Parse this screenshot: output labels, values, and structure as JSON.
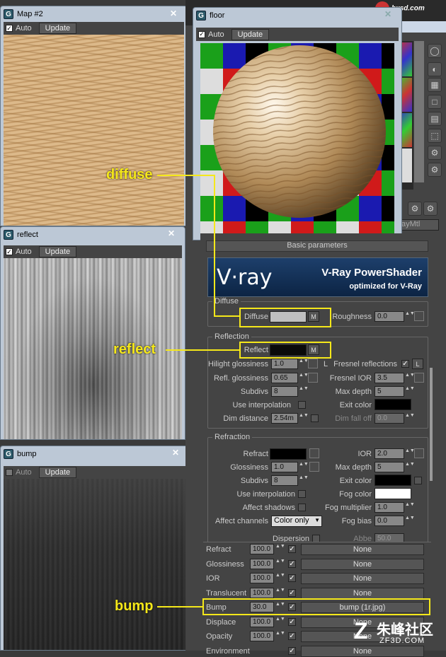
{
  "windows": {
    "map2": {
      "title": "Map #2",
      "auto": "Auto",
      "update": "Update"
    },
    "floor": {
      "title": "floor",
      "auto": "Auto",
      "update": "Update"
    },
    "reflect": {
      "title": "reflect",
      "auto": "Auto",
      "update": "Update"
    },
    "bump": {
      "title": "bump",
      "auto": "Auto",
      "update": "Update"
    }
  },
  "watermarks": {
    "top": "hxsd.com",
    "bottom_cn": "朱峰社区",
    "bottom_en": "ZF3D.COM"
  },
  "material": {
    "type_label": "ayMtl",
    "rollout": "Basic parameters",
    "banner": {
      "brand": "V·ray",
      "title": "V-Ray PowerShader",
      "subtitle": "optimized for V-Ray"
    },
    "diffuse": {
      "group": "Diffuse",
      "diffuse_label": "Diffuse",
      "diffuse_color": "#bfbfbf",
      "m": "M",
      "roughness_label": "Roughness",
      "roughness": "0.0"
    },
    "reflection": {
      "group": "Reflection",
      "reflect_label": "Reflect",
      "reflect_color": "#0a0a0a",
      "m": "M",
      "hilight_label": "Hilight glossiness",
      "hilight": "1.0",
      "l": "L",
      "fresnel_label": "Fresnel reflections",
      "fresnel_checked": "✓",
      "refl_gloss_label": "Refl. glossiness",
      "refl_gloss": "0.65",
      "fresnel_ior_label": "Fresnel IOR",
      "fresnel_ior": "3.5",
      "subdivs_label": "Subdivs",
      "subdivs": "8",
      "max_depth_label": "Max depth",
      "max_depth": "5",
      "use_interp_label": "Use interpolation",
      "exit_color_label": "Exit color",
      "dim_dist_label": "Dim distance",
      "dim_dist": "2.54m",
      "dim_falloff_label": "Dim fall off",
      "dim_falloff": "0.0"
    },
    "refraction": {
      "group": "Refraction",
      "refract_label": "Refract",
      "ior_label": "IOR",
      "ior": "2.0",
      "gloss_label": "Glossiness",
      "gloss": "1.0",
      "max_depth_label": "Max depth",
      "max_depth": "5",
      "subdivs_label": "Subdivs",
      "subdivs": "8",
      "exit_color_label": "Exit color",
      "use_interp_label": "Use interpolation",
      "fog_color_label": "Fog color",
      "affect_shadows_label": "Affect shadows",
      "fog_mult_label": "Fog multiplier",
      "fog_mult": "1.0",
      "affect_channels_label": "Affect channels",
      "affect_channels": "Color only",
      "fog_bias_label": "Fog bias",
      "fog_bias": "0.0",
      "dispersion_label": "Dispersion",
      "abbe_label": "Abbe",
      "abbe": "50.0"
    },
    "maps": [
      {
        "label": "Refract",
        "amount": "100.0",
        "map": "None"
      },
      {
        "label": "Glossiness",
        "amount": "100.0",
        "map": "None"
      },
      {
        "label": "IOR",
        "amount": "100.0",
        "map": "None"
      },
      {
        "label": "Translucent",
        "amount": "100.0",
        "map": "None"
      },
      {
        "label": "Bump",
        "amount": "30.0",
        "map": "bump (1r.jpg)"
      },
      {
        "label": "Displace",
        "amount": "100.0",
        "map": "None"
      },
      {
        "label": "Opacity",
        "amount": "100.0",
        "map": "None"
      },
      {
        "label": "Environment",
        "amount": "",
        "map": "None"
      }
    ]
  },
  "annotations": {
    "diffuse": "diffuse",
    "reflect": "reflect",
    "bump": "bump"
  },
  "colors": {
    "highlight": "#f5e81a",
    "window_frame": "#bcc8d6",
    "panel": "#444444"
  }
}
